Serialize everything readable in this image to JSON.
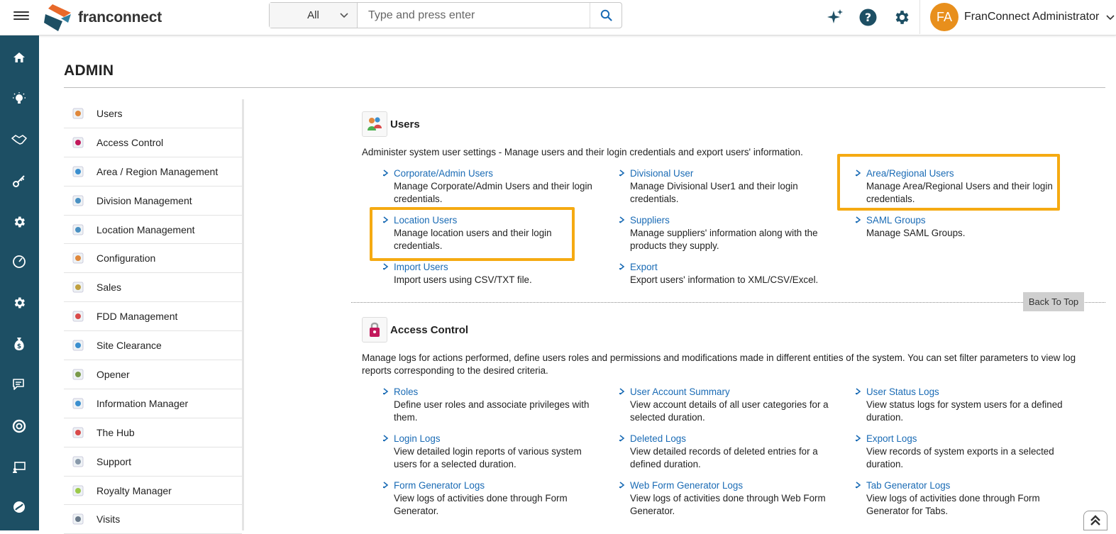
{
  "header": {
    "brand": "franconnect",
    "search_category": "All",
    "search_placeholder": "Type and press enter",
    "user_initials": "FA",
    "user_name": "FranConnect Administrator"
  },
  "page": {
    "title": "ADMIN",
    "back_to_top": "Back To Top"
  },
  "colors": {
    "rail": "#1d4f64",
    "accent": "#f5aa12",
    "avatar": "#e88f1c",
    "link": "#1a6bb5"
  },
  "rail_icons": [
    "home-icon",
    "lightbulb-icon",
    "handshake-icon",
    "key-icon",
    "gear-icon",
    "speedometer-icon",
    "gear-icon",
    "money-bag-icon",
    "chat-icon",
    "lifebuoy-icon",
    "presentation-icon",
    "globe-icon"
  ],
  "left_nav": [
    {
      "label": "Users",
      "icon": "users-icon"
    },
    {
      "label": "Access Control",
      "icon": "access-control-icon"
    },
    {
      "label": "Area / Region Management",
      "icon": "area-region-icon"
    },
    {
      "label": "Division Management",
      "icon": "division-icon"
    },
    {
      "label": "Location Management",
      "icon": "location-icon"
    },
    {
      "label": "Configuration",
      "icon": "configuration-icon"
    },
    {
      "label": "Sales",
      "icon": "sales-icon"
    },
    {
      "label": "FDD Management",
      "icon": "fdd-icon"
    },
    {
      "label": "Site Clearance",
      "icon": "site-clearance-icon"
    },
    {
      "label": "Opener",
      "icon": "opener-icon"
    },
    {
      "label": "Information Manager",
      "icon": "information-manager-icon"
    },
    {
      "label": "The Hub",
      "icon": "hub-icon"
    },
    {
      "label": "Support",
      "icon": "support-icon"
    },
    {
      "label": "Royalty Manager",
      "icon": "royalty-icon"
    },
    {
      "label": "Visits",
      "icon": "visits-icon"
    }
  ],
  "users_section": {
    "title": "Users",
    "description": "Administer system user settings - Manage users and their login credentials and export users' information.",
    "links": [
      {
        "label": "Corporate/Admin Users",
        "desc": "Manage Corporate/Admin Users and their login credentials."
      },
      {
        "label": "Divisional User",
        "desc": "Manage Divisional User1 and their login credentials."
      },
      {
        "label": "Area/Regional Users",
        "desc": "Manage Area/Regional Users and their login credentials."
      },
      {
        "label": "Location Users",
        "desc": "Manage location users and their login credentials."
      },
      {
        "label": "Suppliers",
        "desc": "Manage suppliers' information along with the products they supply."
      },
      {
        "label": "SAML Groups",
        "desc": "Manage SAML Groups."
      },
      {
        "label": "Import Users",
        "desc": "Import users using CSV/TXT file."
      },
      {
        "label": "Export",
        "desc": "Export users' information to XML/CSV/Excel."
      }
    ]
  },
  "access_section": {
    "title": "Access Control",
    "description": "Manage logs for actions performed, define users roles and permissions and modifications made in different entities of the system. You can set filter parameters to view log reports corresponding to the desired criteria.",
    "links": [
      {
        "label": "Roles",
        "desc": "Define user roles and associate privileges with them."
      },
      {
        "label": "User Account Summary",
        "desc": "View account details of all user categories for a selected duration."
      },
      {
        "label": "User Status Logs",
        "desc": "View status logs for system users for a defined duration."
      },
      {
        "label": "Login Logs",
        "desc": "View detailed login reports of various system users for a selected duration."
      },
      {
        "label": "Deleted Logs",
        "desc": "View detailed records of deleted entries for a defined duration."
      },
      {
        "label": "Export Logs",
        "desc": "View records of system exports in a selected duration."
      },
      {
        "label": "Form Generator Logs",
        "desc": "View logs of activities done through Form Generator."
      },
      {
        "label": "Web Form Generator Logs",
        "desc": "View logs of activities done through Web Form Generator."
      },
      {
        "label": "Tab Generator Logs",
        "desc": "View logs of activities done through Form Generator for Tabs."
      }
    ]
  }
}
